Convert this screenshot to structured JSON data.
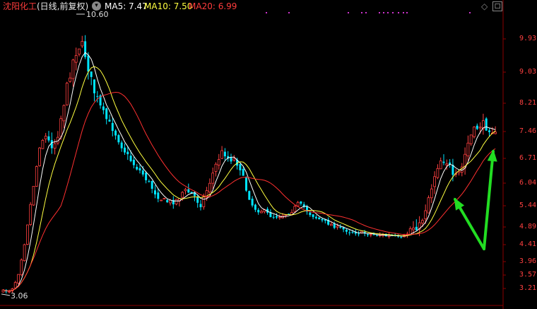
{
  "header": {
    "stock_name": "沈阳化工",
    "period": "(日线,前复权)",
    "ma5": "MA5: 7.47",
    "ma10": "MA10: 7.50",
    "ma20": "MA20: 6.99",
    "dropdown_icon": "chevron-down-icon",
    "settings_icon": "settings-icon"
  },
  "annotations": {
    "high": "10.60",
    "low": "3.06"
  },
  "colors": {
    "up": "#ff4040",
    "down": "#00e5ff",
    "ma5": "#ffffff",
    "ma10": "#ffff40",
    "ma20": "#ff3030",
    "arrow": "#22dd22",
    "axis": "#8b0000",
    "events": "#cc33cc"
  },
  "chart_data": {
    "type": "candlestick",
    "price_axis_ticks": [
      "9.93",
      "9.03",
      "8.21",
      "7.46",
      "6.71",
      "6.04",
      "5.44",
      "4.89",
      "4.41",
      "3.96",
      "3.57",
      "3.21"
    ],
    "price_range": [
      3.0,
      11.0
    ],
    "log_scale": true,
    "grid": false,
    "key_points": [
      {
        "label": "high",
        "value": 10.6
      },
      {
        "label": "low",
        "value": 3.06
      }
    ],
    "ma_latest": {
      "MA5": 7.47,
      "MA10": 7.5,
      "MA20": 6.99
    },
    "arrows": 2
  }
}
